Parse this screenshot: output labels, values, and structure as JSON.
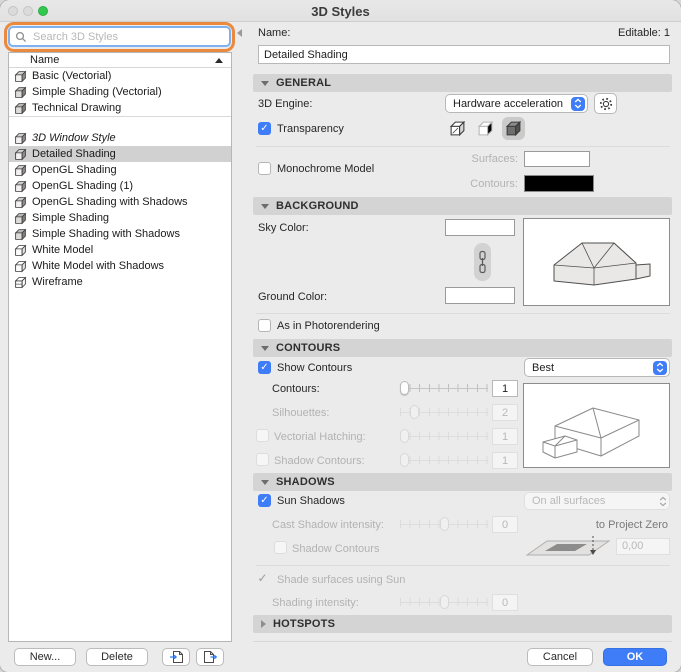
{
  "window": {
    "title": "3D Styles"
  },
  "sidebar": {
    "search_placeholder": "Search 3D Styles",
    "column_header": "Name",
    "items": [
      {
        "label": "Basic (Vectorial)"
      },
      {
        "label": "Simple Shading (Vectorial)"
      },
      {
        "label": "Technical Drawing"
      },
      {
        "label": "3D Window Style"
      },
      {
        "label": "Detailed Shading"
      },
      {
        "label": "OpenGL Shading"
      },
      {
        "label": "OpenGL Shading (1)"
      },
      {
        "label": "OpenGL Shading with Shadows"
      },
      {
        "label": "Simple Shading"
      },
      {
        "label": "Simple Shading with Shadows"
      },
      {
        "label": "White Model"
      },
      {
        "label": "White Model with Shadows"
      },
      {
        "label": "Wireframe"
      }
    ],
    "new_button": "New...",
    "delete_button": "Delete"
  },
  "main": {
    "name_label": "Name:",
    "editable_status": "Editable: 1",
    "name_value": "Detailed Shading",
    "general": {
      "title": "GENERAL",
      "engine_label": "3D Engine:",
      "engine_value": "Hardware acceleration",
      "transparency_label": "Transparency",
      "monochrome_label": "Monochrome Model",
      "surfaces_label": "Surfaces:",
      "contours_label": "Contours:",
      "surfaces_color": "#ffffff",
      "contours_color": "#000000"
    },
    "background": {
      "title": "BACKGROUND",
      "sky_label": "Sky Color:",
      "sky_color": "#ffffff",
      "ground_label": "Ground Color:",
      "ground_color": "#ffffff",
      "photorendering_label": "As in Photorendering"
    },
    "contours": {
      "title": "CONTOURS",
      "show_label": "Show Contours",
      "quality_value": "Best",
      "rows": [
        {
          "label": "Contours:",
          "value": "1"
        },
        {
          "label": "Silhouettes:",
          "value": "2"
        },
        {
          "label": "Vectorial Hatching:",
          "value": "1"
        },
        {
          "label": "Shadow Contours:",
          "value": "1"
        }
      ]
    },
    "shadows": {
      "title": "SHADOWS",
      "sun_label": "Sun Shadows",
      "surface_mode_value": "On all surfaces",
      "cast_label": "Cast Shadow intensity:",
      "cast_value": "0",
      "project_zero_label": "to Project Zero",
      "shadow_contours_label": "Shadow Contours",
      "altitude_value": "0,00",
      "shade_label": "Shade surfaces using Sun",
      "intensity_label": "Shading intensity:",
      "intensity_value": "0"
    },
    "hotspots": {
      "title": "HOTSPOTS"
    }
  },
  "footer": {
    "cancel_label": "Cancel",
    "ok_label": "OK"
  },
  "colors": {
    "accent_blue": "#3e7df7",
    "annotation_orange": "#ea8a3e",
    "selection_gray": "#d2d1d1",
    "section_bar_gray": "#d5d4d4"
  }
}
